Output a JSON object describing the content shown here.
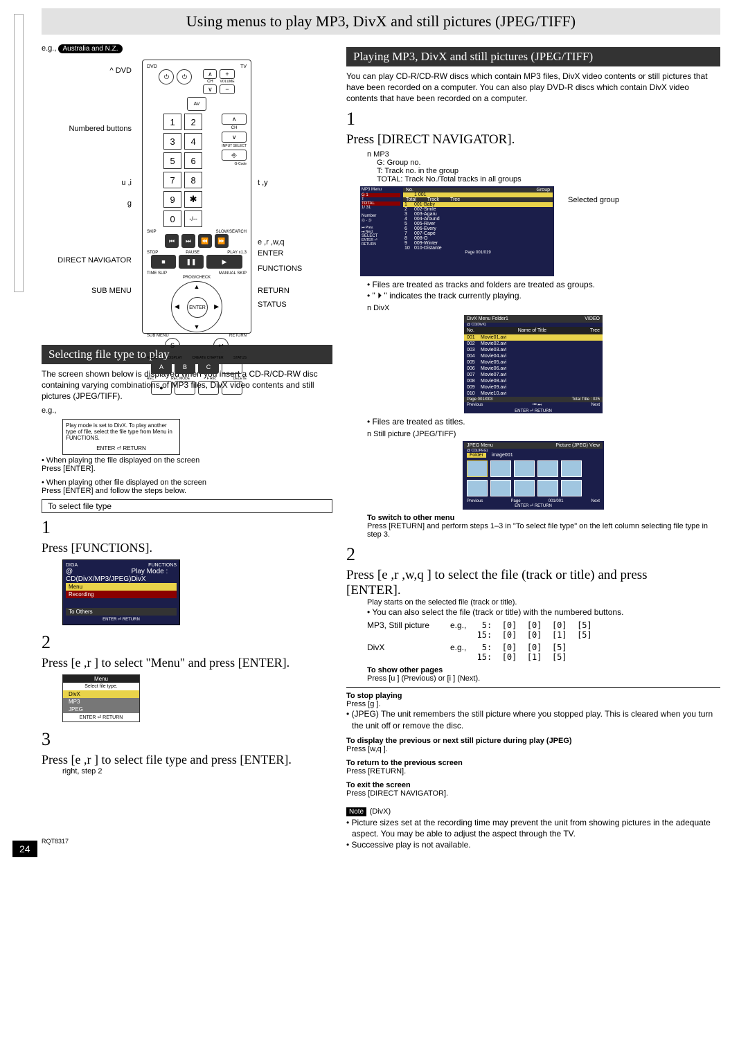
{
  "title": "Using menus to play MP3, DivX and still pictures (JPEG/TIFF)",
  "eg_prefix": "e.g.,",
  "eg_region": "Australia and N.Z.",
  "remote_labels": {
    "dvd": "^ DVD",
    "numbered": "Numbered buttons",
    "ui": "u ,i",
    "g": "g",
    "direct": "DIRECT NAVIGATOR",
    "submenu": "SUB MENU",
    "tv": "TV",
    "ty": "t ,y",
    "erwq": "e ,r ,w,q",
    "enter": "ENTER",
    "functions": "FUNCTIONS",
    "return": "RETURN",
    "status": "STATUS"
  },
  "remote_small_text": {
    "dvd": "DVD",
    "ch": "CH",
    "av": "AV",
    "volume": "VOLUME",
    "input_select": "INPUT SELECT",
    "gcode": "G-Code",
    "skip": "SKIP",
    "slow": "SLOW/SEARCH",
    "stop": "STOP",
    "pause": "PAUSE",
    "play": "PLAY x1.3",
    "timeslip": "TIME SLIP",
    "manual": "MANUAL SKIP",
    "progcheck": "PROG/CHECK",
    "enter_c": "ENTER",
    "submenu_s": "SUB MENU",
    "return_s": "RETURN",
    "audio": "AUDIO",
    "display": "DISPLAY",
    "create": "CREATE CHAPTER",
    "status_s": "STATUS",
    "rec": "REC",
    "recmode": "REC MODE",
    "frec": "F Rec",
    "delete": "DELETE"
  },
  "section_left": {
    "heading": "Selecting file type to play",
    "intro": "The screen shown below is displayed when you insert a CD-R/CD-RW disc containing varying combinations of MP3 files, DivX video contents and still pictures (JPEG/TIFF).",
    "eg": "e.g.,",
    "tip": "Play mode is set to DivX. To play another type of file, select the file type from Menu in FUNCTIONS.",
    "tip_footer": "ENTER ⏎ RETURN",
    "note1": "• When playing the file displayed on the screen",
    "note1b": "Press [ENTER].",
    "note2": "• When playing other file displayed on the screen",
    "note2b": "Press [ENTER] and follow the steps below.",
    "select_label": "To select file type",
    "step1_num": "1",
    "step1_text": "Press [FUNCTIONS].",
    "func_shot": {
      "brand": "DIGA",
      "functions": "FUNCTIONS",
      "sub": "@ CD(DivX/MP3/JPEG)",
      "mode": "Play Mode : DivX",
      "menu": "Menu",
      "recording": "Recording",
      "toothers": "To Others",
      "footer": "ENTER ⏎ RETURN"
    },
    "step2_num": "2",
    "step2_text": "Press [e ,r ] to select \"Menu\" and press [ENTER].",
    "menu_shot": {
      "title": "Menu",
      "subtitle": "Select file type.",
      "items": [
        "DivX",
        "MP3",
        "JPEG"
      ],
      "footer": "ENTER ⏎ RETURN"
    },
    "step3_num": "3",
    "step3_text": "Press [e ,r ] to select file type and press [ENTER].",
    "step3_sub": "right, step 2"
  },
  "section_right": {
    "heading": "Playing MP3, DivX and still pictures (JPEG/TIFF)",
    "intro": "You can play CD-R/CD-RW discs which contain MP3 files, DivX video contents or still pictures that have been recorded on a computer. You can also play DVD-R discs which contain DivX video contents that have been recorded on a computer.",
    "step1_num": "1",
    "step1_text": "Press [DIRECT NAVIGATOR].",
    "mp3_label": "n MP3",
    "mp3_g": "G: Group no.",
    "mp3_t": "T: Track no. in the group",
    "mp3_total": "TOTAL: Track No./Total tracks in all groups",
    "selected_group": "Selected group",
    "nav_shot": {
      "menu": "MP3 Menu",
      "g": "G    1",
      "t": "T",
      "total": "TOTAL",
      "count": "1/   31",
      "number": "Number",
      "prev": "Prev.",
      "next": "Next",
      "select": "SELECT",
      "enter": "ENTER",
      "return": "RETURN",
      "cols": [
        "No.",
        "Group"
      ],
      "grp_sel": "1   001",
      "tabs": [
        "Total",
        "Track",
        "Tree"
      ],
      "tracks": [
        {
          "n": "1",
          "t": "001-Baby"
        },
        {
          "n": "2",
          "t": "002-Smile"
        },
        {
          "n": "3",
          "t": "003-Agaru"
        },
        {
          "n": "4",
          "t": "004-Around"
        },
        {
          "n": "5",
          "t": "005-River"
        },
        {
          "n": "6",
          "t": "006-Every"
        },
        {
          "n": "7",
          "t": "007-Cape"
        },
        {
          "n": "8",
          "t": "008-O"
        },
        {
          "n": "9",
          "t": "009-Winter"
        },
        {
          "n": "10",
          "t": "010-Distante"
        }
      ],
      "page": "Page 001/019"
    },
    "bullet_tracks": "Files are treated as tracks and folders are treated as groups.",
    "bullet_icon": "\" ⏵ \" indicates the track currently playing.",
    "divx_label": "n DivX",
    "divx_shot": {
      "title": "DivX Menu",
      "sub": "@ CD(DivX)",
      "folder": "Folder1",
      "video": "VIDEO",
      "col": "Name of Title",
      "tree": "Tree",
      "items": [
        {
          "n": "001",
          "t": "Movie01.avi"
        },
        {
          "n": "002",
          "t": "Movie02.avi"
        },
        {
          "n": "003",
          "t": "Movie03.avi"
        },
        {
          "n": "004",
          "t": "Movie04.avi"
        },
        {
          "n": "005",
          "t": "Movie05.avi"
        },
        {
          "n": "006",
          "t": "Movie06.avi"
        },
        {
          "n": "007",
          "t": "Movie07.avi"
        },
        {
          "n": "008",
          "t": "Movie08.avi"
        },
        {
          "n": "009",
          "t": "Movie09.avi"
        },
        {
          "n": "010",
          "t": "Movie10.avi"
        }
      ],
      "page": "Page 001/003",
      "total": "Total Title : 025",
      "prev": "Previous",
      "next": "Next",
      "footer": "ENTER ⏎ RETURN"
    },
    "bullet_titles": "Files are treated as titles.",
    "jpeg_label": "n Still picture (JPEG/TIFF)",
    "jpeg_shot": {
      "title": "JPEG Menu",
      "sub": "@ CD(JPEG)",
      "view": "Picture (JPEG) View",
      "folder": "Folder",
      "image": "image001",
      "prev": "Previous",
      "page": "Page",
      "pnum": "001/001",
      "next": "Next",
      "footer": "ENTER ⏎ RETURN"
    },
    "switch_title": "To switch to other menu",
    "switch_body": "Press [RETURN] and perform steps 1–3 in \"To select file type\" on the left column selecting file type in step 3.",
    "step2_num": "2",
    "step2_text": "Press [e ,r ,w,q ] to select the file (track or title) and press [ENTER].",
    "step2_sub1": "Play starts on the selected file (track or title).",
    "step2_sub2": "• You can also select the file (track or title) with the numbered buttons.",
    "table_row1_label": "MP3, Still picture",
    "table_row2_label": "DivX",
    "table_eg": "e.g.,",
    "table_rows": "  5:  [0]  [0]  [0]  [5]\n 15:  [0]  [0]  [1]  [5]",
    "table_rows2": "  5:  [0]  [0]  [5]\n 15:  [0]  [1]  [5]",
    "show_pages": "To show other pages",
    "show_pages_body": "Press [u   ] (Previous) or [i    ] (Next).",
    "stop_title": "To stop playing",
    "stop_body": "Press [g ].",
    "stop_bullet": "• (JPEG) The unit remembers the still picture where you stopped play. This is cleared when you turn the unit off or remove the disc.",
    "disp_title": "To display the previous or next still picture during play (JPEG)",
    "disp_body": "Press [w,q ].",
    "return_title": "To return to the previous screen",
    "return_body": "Press [RETURN].",
    "exit_title": "To exit the screen",
    "exit_body": "Press [DIRECT NAVIGATOR].",
    "note_label": "Note",
    "note_divx": "(DivX)",
    "note_bullet1": "• Picture sizes set at the recording time may prevent the unit from showing pictures in the adequate aspect. You may be able to adjust the aspect through the TV.",
    "note_bullet2": "• Successive play is not available."
  },
  "page_num": "24",
  "rqt": "RQT8317"
}
